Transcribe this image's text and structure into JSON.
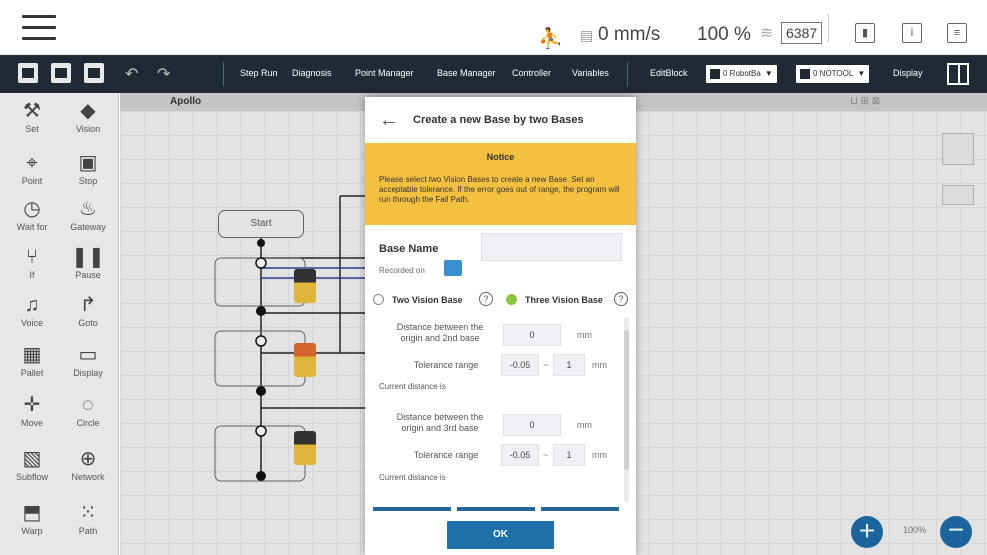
{
  "status_bar": {
    "speed": "0 mm/s",
    "percent": "100 %",
    "counter": "6387"
  },
  "toolbar": {
    "step_run": "Step Run",
    "diagnosis": "Diagnosis",
    "point_manager": "Point Manager",
    "base_manager": "Base Manager",
    "controller": "Controller",
    "variables": "Variables",
    "editblock": "EditBlock",
    "robot_select": "0 RobotBa",
    "tool_select": "0 NOTOOL",
    "display": "Display"
  },
  "palette": {
    "set": "Set",
    "vision": "Vision",
    "point": "Point",
    "stop": "Stop",
    "wait_for": "Wait for",
    "gateway": "Gateway",
    "if": "If",
    "pause": "Pause",
    "voice": "Voice",
    "goto": "Goto",
    "pallet": "Pallet",
    "display": "Display",
    "move": "Move",
    "circle": "Circle",
    "subflow": "Subflow",
    "network": "Network",
    "warp": "Warp",
    "path": "Path"
  },
  "canvas": {
    "project_title": "Apollo",
    "start_label": "Start",
    "zoom_level": "100%"
  },
  "modal": {
    "title": "Create a new Base by two Bases",
    "notice_title": "Notice",
    "notice_body": "Please select two Vision Bases to create a new Base. Set an acceptable tolerance. If the error goes out of range, the program will run through the Fail Path.",
    "base_name_label": "Base Name",
    "base_name_value": "",
    "recorded_on_label": "Recorded on",
    "option_two": "Two Vision Base",
    "option_three": "Three Vision Base",
    "selected_option": "Three Vision Base",
    "dist2_label": "Distance between the origin and 2nd base",
    "dist2_value": "0",
    "dist2_unit": "mm",
    "tol2_label": "Tolerance range",
    "tol2_min": "-0.05",
    "tol2_max": "1",
    "tol2_unit": "mm",
    "current2_label": "Current distance is",
    "dist3_label": "Distance between the origin and 3rd base",
    "dist3_value": "0",
    "dist3_unit": "mm",
    "tol3_label": "Tolerance range",
    "tol3_min": "-0.05",
    "tol3_max": "1",
    "tol3_unit": "mm",
    "current3_label": "Current distance is",
    "tilde": "~",
    "ok_label": "OK"
  },
  "colors": {
    "toolbar_bg": "#1f2a35",
    "notice_bg": "#f4c03f",
    "accent_blue": "#1f6fa8",
    "selected_radio": "#8cc63f",
    "status_green": "#7ab317"
  }
}
